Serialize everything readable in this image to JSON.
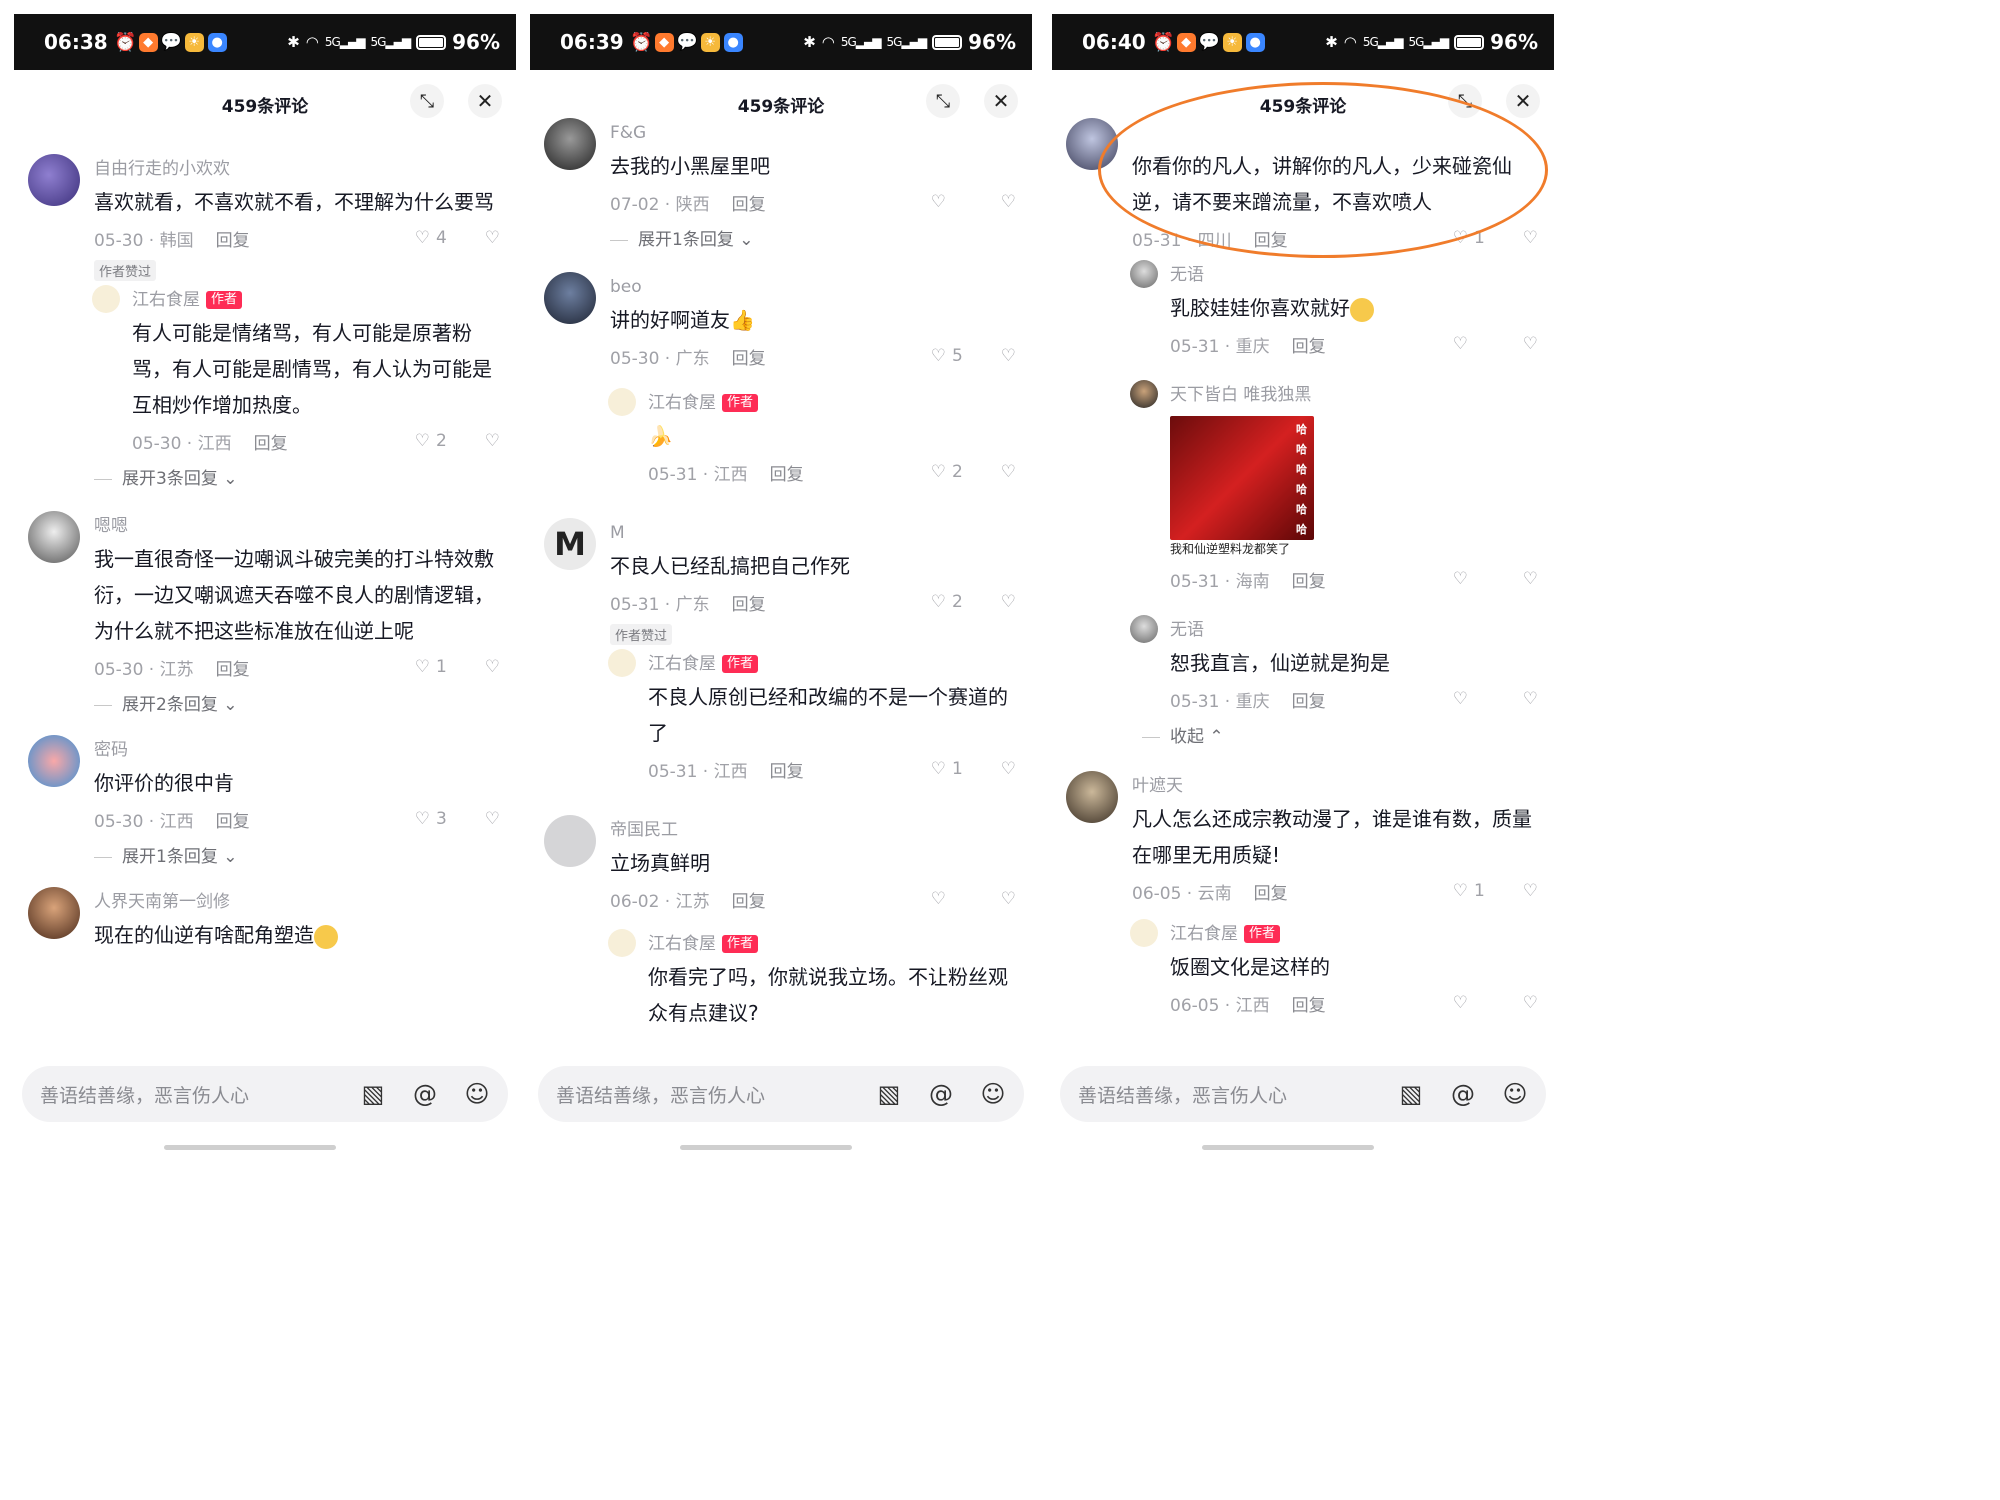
{
  "header": {
    "title": "459条评论"
  },
  "input": {
    "placeholder": "善语结善缘，恶言伤人心"
  },
  "panels": [
    {
      "time": "06:38",
      "battery": "96%",
      "comments": [
        {
          "name": "自由行走的小欢欢",
          "text": "喜欢就看，不喜欢就不看，不理解为什么要骂",
          "date": "05-30 · 韩国",
          "reply_label": "回复",
          "likes": "4",
          "tag": "作者赞过",
          "reply": {
            "name": "江右食屋",
            "badge": "作者",
            "text": "有人可能是情绪骂，有人可能是原著粉骂，有人可能是剧情骂，有人认为可能是互相炒作增加热度。",
            "date": "05-30 · 江西",
            "reply_label": "回复",
            "likes": "2"
          },
          "expand": "展开3条回复"
        },
        {
          "name": "嗯嗯",
          "text": "我一直很奇怪一边嘲讽斗破完美的打斗特效敷衍，一边又嘲讽遮天吞噬不良人的剧情逻辑，为什么就不把这些标准放在仙逆上呢",
          "date": "05-30 · 江苏",
          "reply_label": "回复",
          "likes": "1",
          "expand": "展开2条回复"
        },
        {
          "name": "密码",
          "text": "你评价的很中肯",
          "date": "05-30 · 江西",
          "reply_label": "回复",
          "likes": "3",
          "expand": "展开1条回复"
        },
        {
          "name": "人界天南第一剑修",
          "text": "现在的仙逆有啥配角塑造"
        }
      ]
    },
    {
      "time": "06:39",
      "battery": "96%",
      "comments": [
        {
          "name": "F&G",
          "text": "去我的小黑屋里吧",
          "date": "07-02 · 陕西",
          "reply_label": "回复",
          "likes": "",
          "expand": "展开1条回复"
        },
        {
          "name": "beo",
          "text": "讲的好啊道友",
          "date": "05-30 · 广东",
          "reply_label": "回复",
          "likes": "5",
          "reply": {
            "name": "江右食屋",
            "badge": "作者",
            "text": "",
            "date": "05-31 · 江西",
            "reply_label": "回复",
            "likes": "2"
          }
        },
        {
          "name": "M",
          "text": "不良人已经乱搞把自己作死",
          "date": "05-31 · 广东",
          "reply_label": "回复",
          "likes": "2",
          "tag": "作者赞过",
          "reply": {
            "name": "江右食屋",
            "badge": "作者",
            "text": "不良人原创已经和改编的不是一个赛道的了",
            "date": "05-31 · 江西",
            "reply_label": "回复",
            "likes": "1"
          }
        },
        {
          "name": "帝国民工",
          "text": "立场真鲜明",
          "date": "06-02 · 江苏",
          "reply_label": "回复",
          "likes": "",
          "reply": {
            "name": "江右食屋",
            "badge": "作者",
            "text": "你看完了吗，你就说我立场。不让粉丝观众有点建议?"
          }
        }
      ]
    },
    {
      "time": "06:40",
      "battery": "96%",
      "comments": [
        {
          "name": "",
          "text": "你看你的凡人，讲解你的凡人，少来碰瓷仙逆，请不要来蹭流量，不喜欢喷人",
          "date": "05-31 · 四川",
          "reply_label": "回复",
          "likes": "1",
          "replies": [
            {
              "name": "无语",
              "text": "乳胶娃娃你喜欢就好",
              "date": "05-31 · 重庆",
              "reply_label": "回复",
              "likes": ""
            },
            {
              "name": "天下皆白 唯我独黑",
              "image_caption": "我和仙逆塑料龙都笑了",
              "image_overlay": "哈哈哈哈哈哈",
              "date": "05-31 · 海南",
              "reply_label": "回复",
              "likes": ""
            },
            {
              "name": "无语",
              "text": "恕我直言，仙逆就是狗是",
              "date": "05-31 · 重庆",
              "reply_label": "回复",
              "likes": ""
            }
          ],
          "expand": "收起"
        },
        {
          "name": "叶遮天",
          "text": "凡人怎么还成宗教动漫了，谁是谁有数，质量在哪里无用质疑!",
          "date": "06-05 · 云南",
          "reply_label": "回复",
          "likes": "1",
          "reply": {
            "name": "江右食屋",
            "badge": "作者",
            "text": "饭圈文化是这样的",
            "date": "06-05 · 江西",
            "reply_label": "回复",
            "likes": ""
          }
        }
      ]
    }
  ],
  "colors": {
    "author_badge": "#fe2c55",
    "annotation_circle": "#f07c2b",
    "status_bar": "#111111"
  }
}
